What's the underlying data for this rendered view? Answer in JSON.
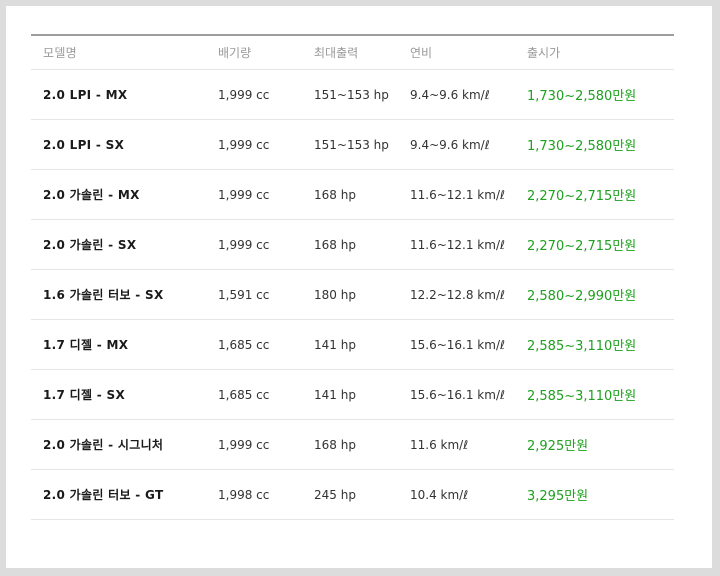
{
  "table": {
    "headers": [
      "모델명",
      "배기량",
      "최대출력",
      "연비",
      "출시가"
    ],
    "rows": [
      [
        "2.0 LPI - MX",
        "1,999 cc",
        "151~153 hp",
        "9.4~9.6 km/ℓ",
        "1,730~2,580만원"
      ],
      [
        "2.0 LPI - SX",
        "1,999 cc",
        "151~153 hp",
        "9.4~9.6 km/ℓ",
        "1,730~2,580만원"
      ],
      [
        "2.0 가솔린 - MX",
        "1,999 cc",
        "168 hp",
        "11.6~12.1 km/ℓ",
        "2,270~2,715만원"
      ],
      [
        "2.0 가솔린 - SX",
        "1,999 cc",
        "168 hp",
        "11.6~12.1 km/ℓ",
        "2,270~2,715만원"
      ],
      [
        "1.6 가솔린 터보 - SX",
        "1,591 cc",
        "180 hp",
        "12.2~12.8 km/ℓ",
        "2,580~2,990만원"
      ],
      [
        "1.7 디젤 - MX",
        "1,685 cc",
        "141 hp",
        "15.6~16.1 km/ℓ",
        "2,585~3,110만원"
      ],
      [
        "1.7 디젤 - SX",
        "1,685 cc",
        "141 hp",
        "15.6~16.1 km/ℓ",
        "2,585~3,110만원"
      ],
      [
        "2.0 가솔린 - 시그니처",
        "1,999 cc",
        "168 hp",
        "11.6 km/ℓ",
        "2,925만원"
      ],
      [
        "2.0 가솔린 터보 - GT",
        "1,998 cc",
        "245 hp",
        "10.4 km/ℓ",
        "3,295만원"
      ]
    ]
  },
  "colors": {
    "price": "#1fa01f",
    "header_text": "#999999",
    "top_rule": "#9e9e9e"
  }
}
